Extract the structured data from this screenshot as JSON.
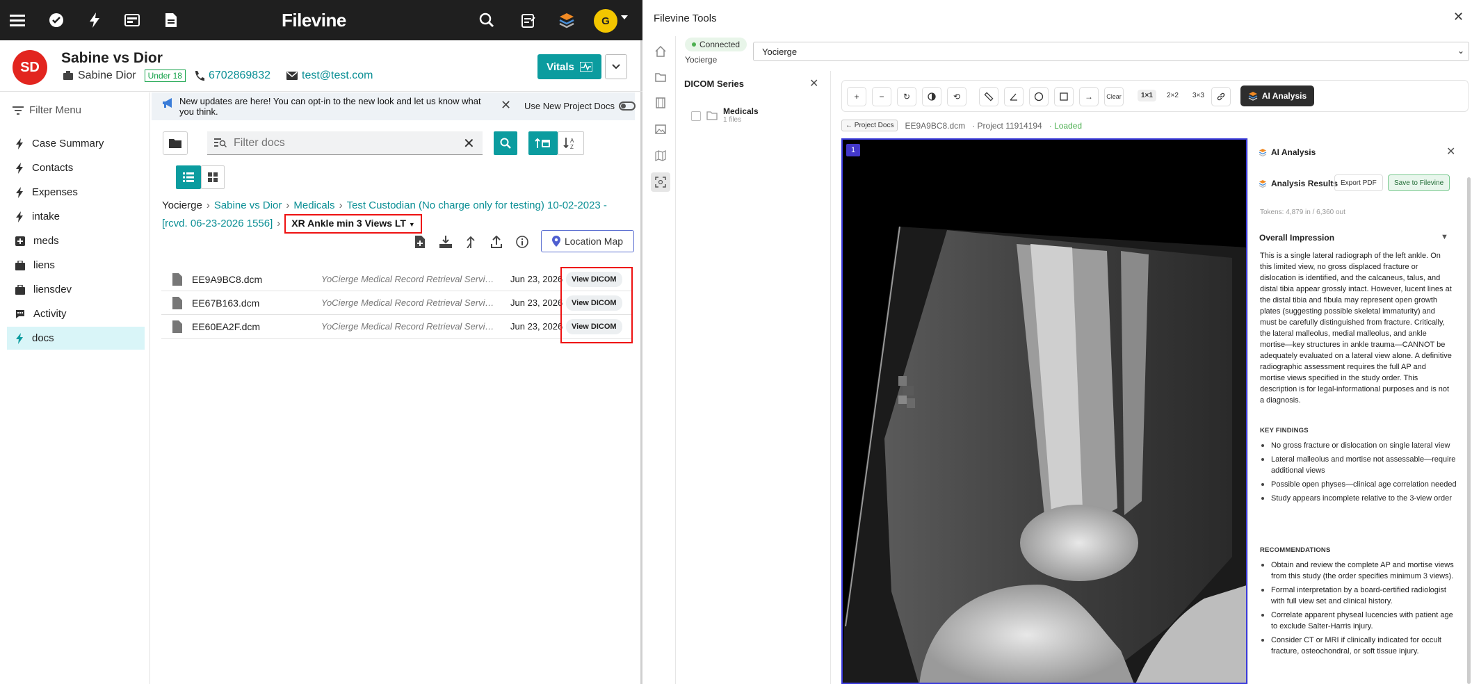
{
  "topbar": {
    "logo": "Filevine",
    "avatar_initial": "G"
  },
  "case": {
    "avatar": "SD",
    "title": "Sabine vs Dior",
    "client": "Sabine Dior",
    "badge": "Under 18",
    "phone": "6702869832",
    "email": "test@test.com",
    "vitals_label": "Vitals"
  },
  "sidebar": {
    "filter_label": "Filter Menu",
    "items": [
      {
        "label": "Case Summary"
      },
      {
        "label": "Contacts"
      },
      {
        "label": "Expenses"
      },
      {
        "label": "intake"
      },
      {
        "label": "meds"
      },
      {
        "label": "liens"
      },
      {
        "label": "liensdev"
      },
      {
        "label": "Activity"
      },
      {
        "label": "docs"
      }
    ]
  },
  "notice": {
    "text": "New updates are here! You can opt-in to the new look and let us know what you think.",
    "toggle_label": "Use New Project Docs"
  },
  "docs": {
    "filter_placeholder": "Filter docs",
    "breadcrumb": {
      "root": "Yocierge",
      "b1": "Sabine vs Dior",
      "b2": "Medicals",
      "b3": "Test Custodian (No charge only for testing) 10-02-2023 - [rcvd. 06-23-2026 1556]",
      "current": "XR Ankle min 3 Views LT"
    },
    "location_map": "Location Map",
    "rows": [
      {
        "name": "EE9A9BC8.dcm",
        "source": "YoCierge Medical Record Retrieval Servic...",
        "date": "Jun 23, 2026",
        "action": "View DICOM"
      },
      {
        "name": "EE67B163.dcm",
        "source": "YoCierge Medical Record Retrieval Servic...",
        "date": "Jun 23, 2026",
        "action": "View DICOM"
      },
      {
        "name": "EE60EA2F.dcm",
        "source": "YoCierge Medical Record Retrieval Servic...",
        "date": "Jun 23, 2026",
        "action": "View DICOM"
      }
    ]
  },
  "tools": {
    "title": "Filevine Tools",
    "status": "Connected",
    "org": "Yocierge",
    "project_select": "Yocierge",
    "dicom_title": "DICOM Series",
    "series": {
      "name": "Medicals",
      "sub": "1 files"
    },
    "toolbar": {
      "clear": "Clear",
      "g1": "1×1",
      "g2": "2×2",
      "g3": "3×3",
      "ai": "AI Analysis"
    },
    "project_bar": {
      "back": "← Project Docs",
      "file": "EE9A9BC8.dcm",
      "project": "· Project 11914194",
      "status": "· Loaded"
    },
    "viewport_index": "1"
  },
  "ai": {
    "title": "AI Analysis",
    "results_title": "Analysis Results",
    "export_pdf": "Export PDF",
    "save": "Save to Filevine",
    "tokens": "Tokens: 4,879 in / 6,360 out",
    "overall_title": "Overall Impression",
    "overall_text": "This is a single lateral radiograph of the left ankle. On this limited view, no gross displaced fracture or dislocation is identified, and the calcaneus, talus, and distal tibia appear grossly intact. However, lucent lines at the distal tibia and fibula may represent open growth plates (suggesting possible skeletal immaturity) and must be carefully distinguished from fracture. Critically, the lateral malleolus, medial malleolus, and ankle mortise—key structures in ankle trauma—CANNOT be adequately evaluated on a lateral view alone. A definitive radiographic assessment requires the full AP and mortise views specified in the study order. This description is for legal-informational purposes and is not a diagnosis.",
    "key_findings_title": "KEY FINDINGS",
    "key_findings": [
      "No gross fracture or dislocation on single lateral view",
      "Lateral malleolus and mortise not assessable—require additional views",
      "Possible open physes—clinical age correlation needed",
      "Study appears incomplete relative to the 3-view order"
    ],
    "recommendations_title": "RECOMMENDATIONS",
    "recommendations": [
      "Obtain and review the complete AP and mortise views from this study (the order specifies minimum 3 views).",
      "Formal interpretation by a board-certified radiologist with full view set and clinical history.",
      "Correlate apparent physeal lucencies with patient age to exclude Salter-Harris injury.",
      "Consider CT or MRI if clinically indicated for occult fracture, osteochondral, or soft tissue injury."
    ]
  },
  "colors": {
    "teal": "#0b9c9f",
    "red": "#e2251f",
    "dark": "#1f1f1f",
    "viewer_border": "#3b3bdc"
  }
}
